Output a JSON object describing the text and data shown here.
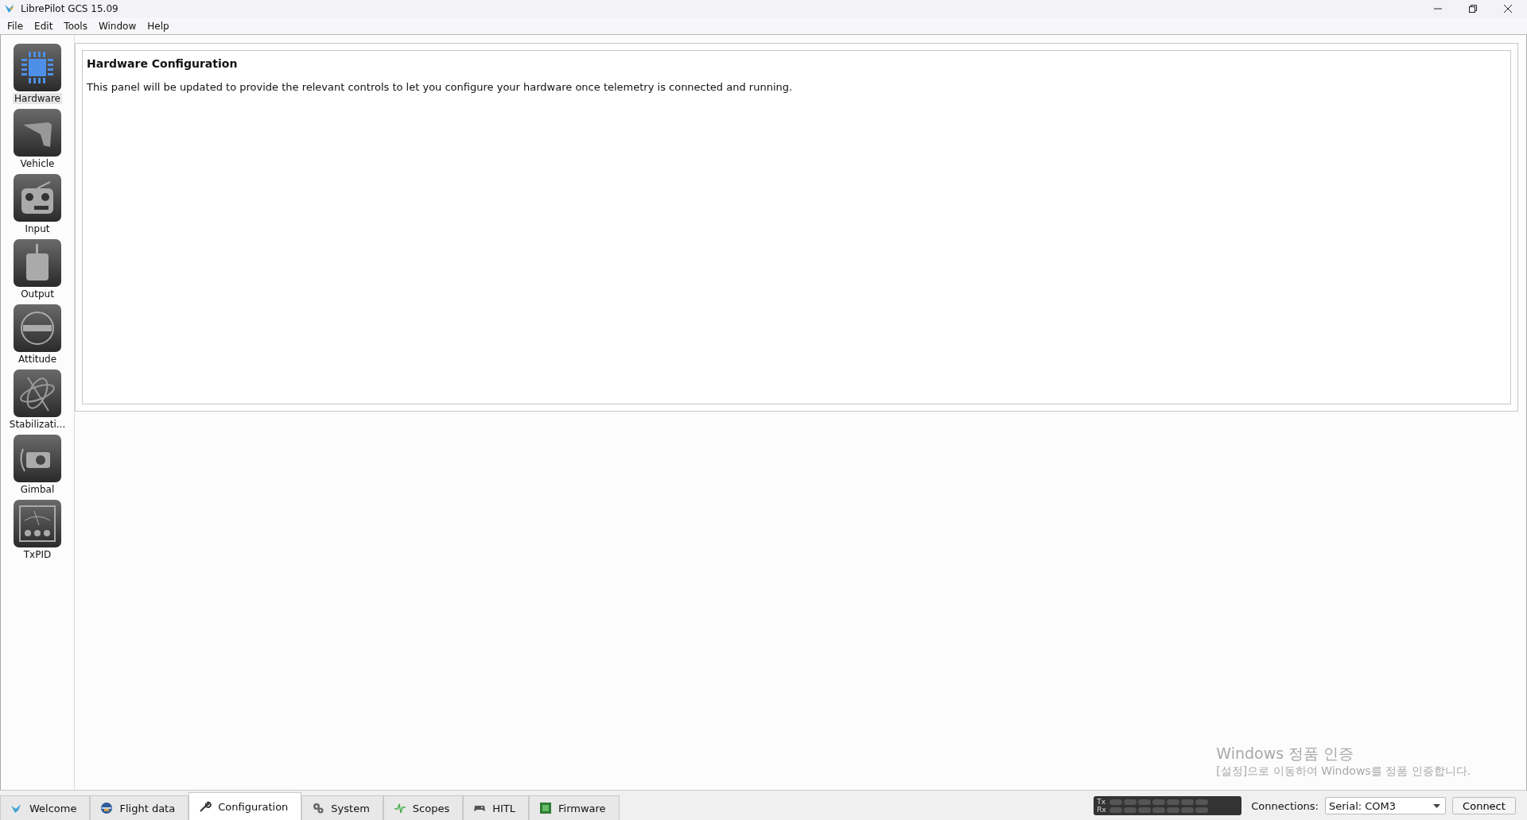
{
  "window": {
    "title": "LibrePilot GCS 15.09"
  },
  "menu": [
    "File",
    "Edit",
    "Tools",
    "Window",
    "Help"
  ],
  "sidebar": {
    "items": [
      {
        "label": "Hardware",
        "selected": true
      },
      {
        "label": "Vehicle",
        "selected": false
      },
      {
        "label": "Input",
        "selected": false
      },
      {
        "label": "Output",
        "selected": false
      },
      {
        "label": "Attitude",
        "selected": false
      },
      {
        "label": "Stabilizati...",
        "selected": false
      },
      {
        "label": "Gimbal",
        "selected": false
      },
      {
        "label": "TxPID",
        "selected": false
      }
    ]
  },
  "panel": {
    "title": "Hardware Configuration",
    "message": "This panel will be updated to provide the relevant controls to let you configure your hardware once telemetry is connected and running."
  },
  "activation_notice": {
    "title": "Windows 정품 인증",
    "message": "[설정]으로 이동하여 Windows를 정품 인증합니다."
  },
  "tabs": [
    {
      "label": "Welcome",
      "selected": false
    },
    {
      "label": "Flight data",
      "selected": false
    },
    {
      "label": "Configuration",
      "selected": true
    },
    {
      "label": "System",
      "selected": false
    },
    {
      "label": "Scopes",
      "selected": false
    },
    {
      "label": "HITL",
      "selected": false
    },
    {
      "label": "Firmware",
      "selected": false
    }
  ],
  "telemetry": {
    "tx_label": "Tx",
    "rx_label": "Rx"
  },
  "connections": {
    "label": "Connections:",
    "value": "Serial: COM3",
    "button": "Connect"
  }
}
